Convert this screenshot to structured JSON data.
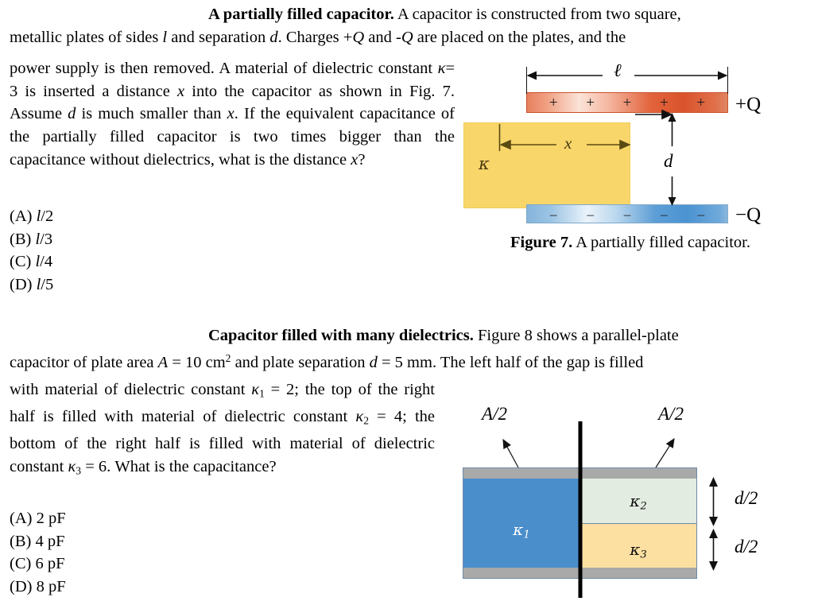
{
  "problem1": {
    "title": "A partially filled capacitor.",
    "body_line1": "A capacitor is constructed from two square,",
    "body_rest_a": "metallic plates of sides l and separation d. Charges +Q and -Q are placed on the plates, and the",
    "body_col": "power supply is then removed. A material of dielectric constant κ = 3 is inserted a distance x into the capacitor as shown in Fig. 7. Assume d is much smaller than x. If the equivalent capacitance of the partially filled capacitor is two times bigger than the capacitance without dielectrics, what is the distance x?",
    "choices": [
      "(A) l/2",
      "(B) l/3",
      "(C) l/4",
      "(D) l/5"
    ],
    "figure": {
      "caption_bold": "Figure 7.",
      "caption_rest": "A partially filled capacitor.",
      "label_length": "ℓ",
      "label_x": "x",
      "label_d": "d",
      "label_kappa": "κ",
      "label_plus_q": "+Q",
      "label_minus_q": "−Q",
      "plus_signs": [
        "+",
        "+",
        "+",
        "+",
        "+"
      ],
      "minus_signs": [
        "−",
        "−",
        "−",
        "−",
        "−"
      ],
      "colors": {
        "top_plate": "#d9532c",
        "bottom_plate": "#4b93d2",
        "dielectric": "#f8d66a"
      }
    }
  },
  "problem2": {
    "title": "Capacitor filled with many dielectrics.",
    "body_line1": "Figure 8 shows a parallel-plate",
    "body_rest_a": "capacitor of plate area A = 10 cm2 and plate separation d = 5 mm. The left half of the gap is filled",
    "body_col": "with material of dielectric constant κ1 = 2; the top of the right half is filled with material of dielectric constant κ2 = 4; the bottom of the right half is filled with material of dielectric constant κ3 = 6. What is the capacitance?",
    "choices": [
      "(A) 2 pF",
      "(B) 4 pF",
      "(C) 6 pF",
      "(D) 8 pF"
    ],
    "figure": {
      "label_area_left": "A/2",
      "label_area_right": "A/2",
      "label_d_top": "d/2",
      "label_d_bottom": "d/2",
      "label_k1": "κ1",
      "label_k2": "κ2",
      "label_k3": "κ3",
      "colors": {
        "k1": "#4a8ecb",
        "k2": "#e3ece1",
        "k3": "#fce0a1",
        "plate": "#a9a9a9"
      }
    }
  }
}
